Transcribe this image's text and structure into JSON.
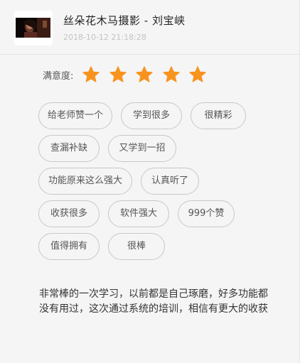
{
  "header": {
    "title": "丝朵花木马摄影 - 刘宝峡",
    "timestamp": "2018-10-12 21:18:28",
    "thumbnail_icon": "video-thumbnail"
  },
  "rating": {
    "label": "满意度:",
    "stars": 5,
    "max_stars": 5,
    "star_color": "#f8931f"
  },
  "tags": [
    "给老师赞一个",
    "学到很多",
    "很精彩",
    "查漏补缺",
    "又学到一招",
    "功能原来这么强大",
    "认真听了",
    "收获很多",
    "软件强大",
    "999个赞",
    "值得拥有",
    "很棒"
  ],
  "comment": "非常棒的一次学习，以前都是自己琢磨，好多功能都没有用过，这次通过系统的培训，相信有更大的收获"
}
